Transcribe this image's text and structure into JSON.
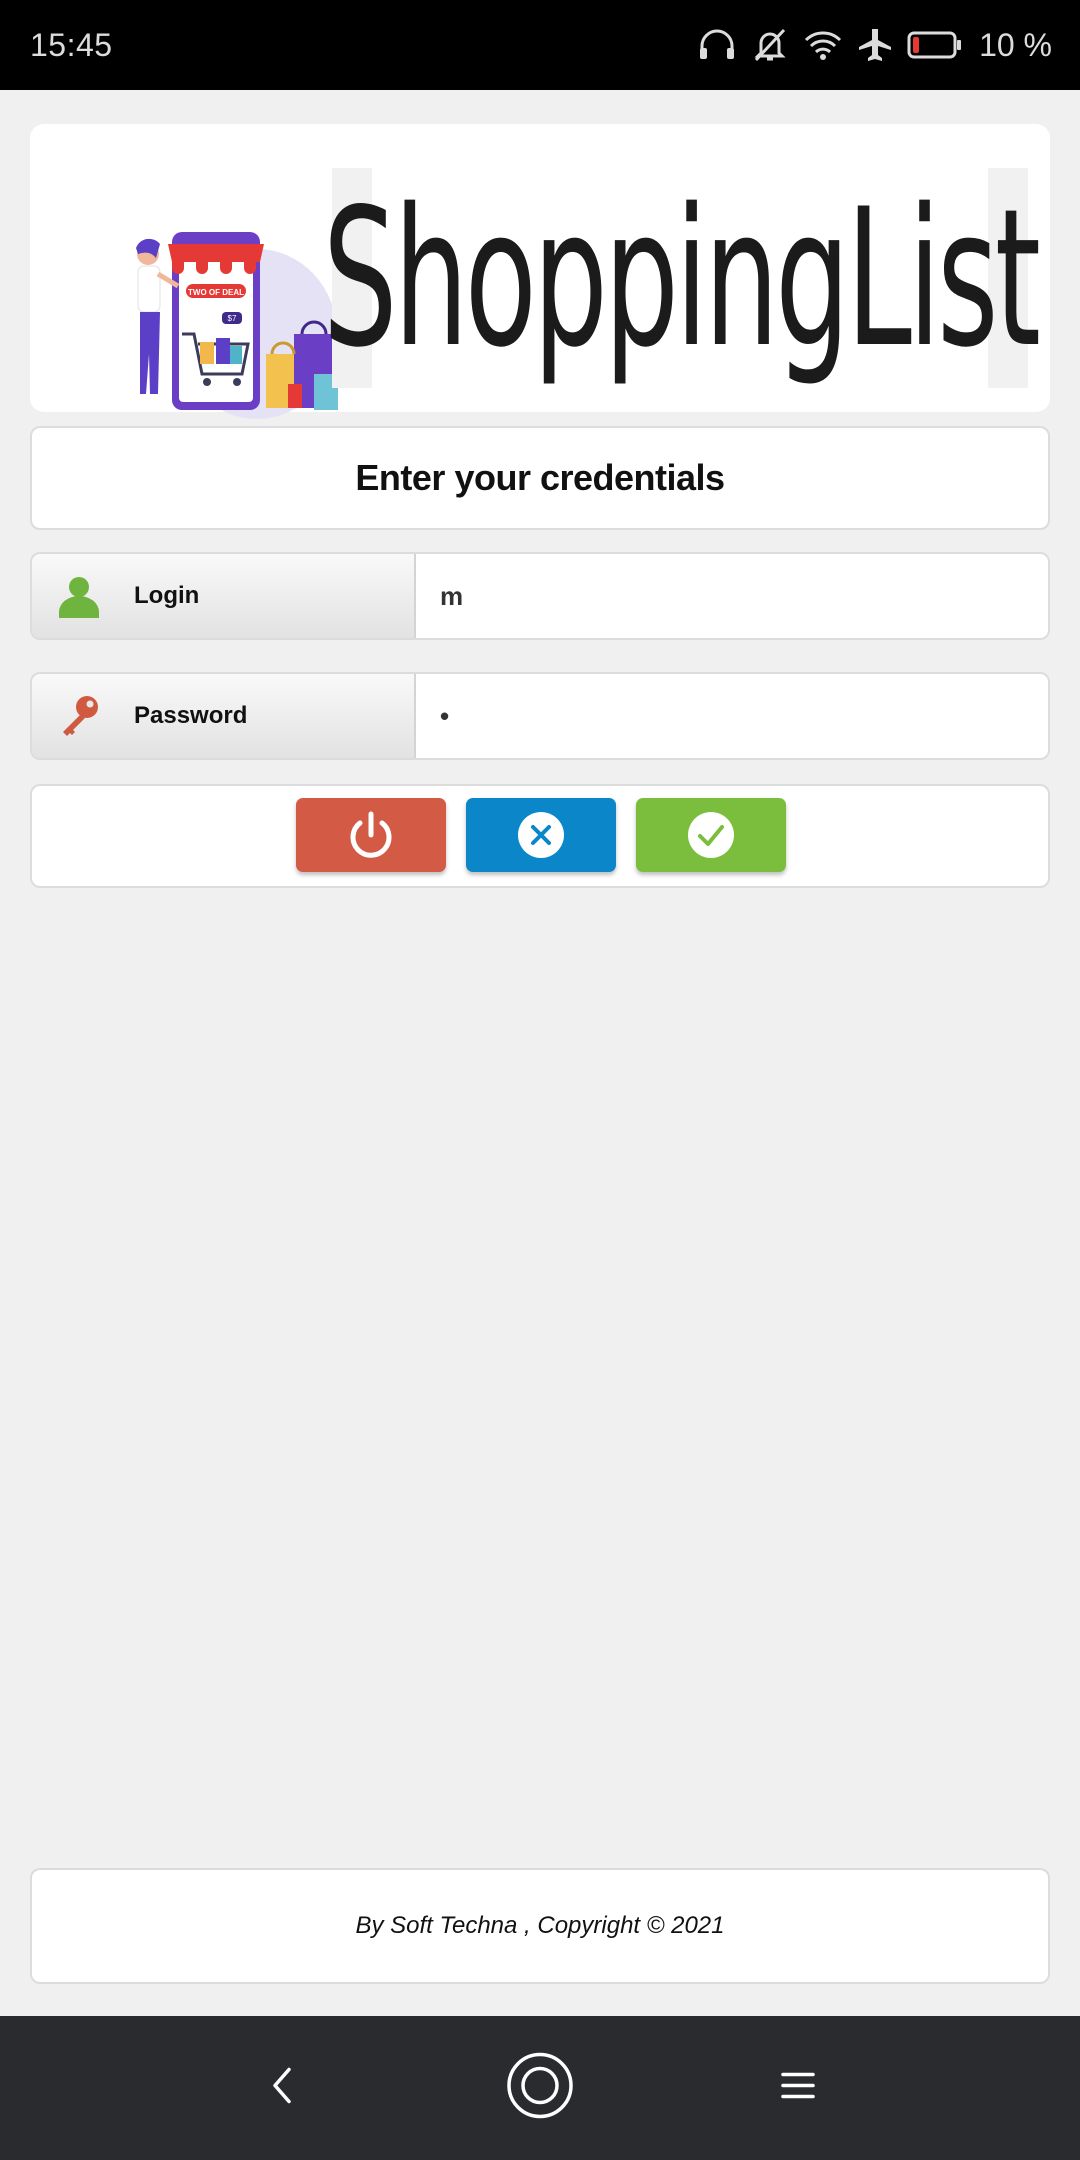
{
  "status_bar": {
    "time": "15:45",
    "battery_percent": "10 %",
    "icons": [
      "headset-icon",
      "bell-off-icon",
      "wifi-icon",
      "airplane-mode-icon",
      "battery-low-icon"
    ]
  },
  "logo": {
    "illustration_icon": "shopping-cart-illustration",
    "sign_text": "TWO OF DEAL",
    "badge_text": "$7",
    "wordmark": "ShoppingList"
  },
  "form": {
    "title": "Enter your credentials",
    "login": {
      "label": "Login",
      "icon": "user-icon",
      "value": "m"
    },
    "password": {
      "label": "Password",
      "icon": "key-icon",
      "value": "•"
    }
  },
  "actions": [
    {
      "name": "power",
      "icon": "power-icon",
      "color": "#d35a45"
    },
    {
      "name": "cancel",
      "icon": "close-circle-icon",
      "color": "#0b86c9"
    },
    {
      "name": "confirm",
      "icon": "check-circle-icon",
      "color": "#7bbd3d"
    }
  ],
  "footer": {
    "text": "By Soft Techna , Copyright © 2021"
  },
  "nav_bar": {
    "icons": [
      "back-icon",
      "home-icon",
      "menu-icon"
    ]
  }
}
